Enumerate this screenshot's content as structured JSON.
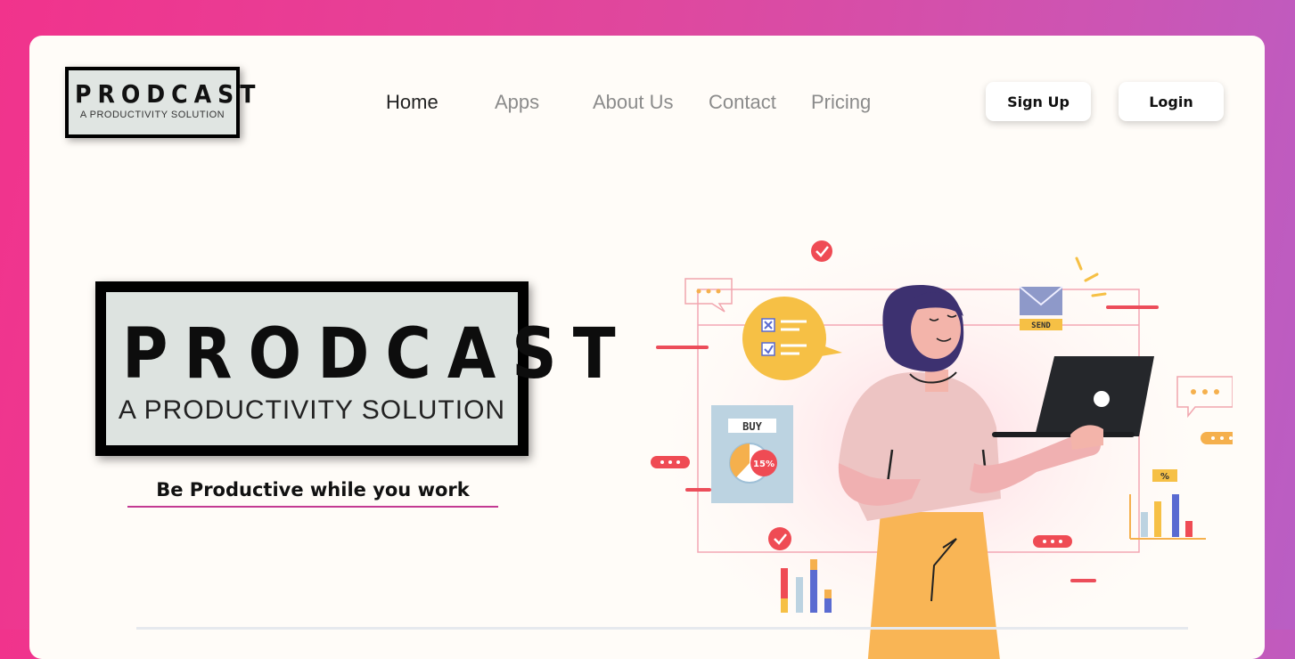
{
  "brand": {
    "name": "PRODCAST",
    "subtitle": "A PRODUCTIVITY SOLUTION"
  },
  "nav": {
    "items": [
      {
        "label": "Home",
        "active": true
      },
      {
        "label": "Apps",
        "active": false
      },
      {
        "label": "About Us",
        "active": false
      },
      {
        "label": "Contact",
        "active": false
      },
      {
        "label": "Pricing",
        "active": false
      }
    ]
  },
  "auth": {
    "signup_label": "Sign Up",
    "login_label": "Login"
  },
  "hero": {
    "title": "PRODCAST",
    "subtitle": "A PRODUCTIVITY SOLUTION",
    "tagline": "Be Productive while you work"
  },
  "illustration": {
    "buy_label": "BUY",
    "discount_label": "15%",
    "send_label": "SEND",
    "percent_label": "%"
  },
  "colors": {
    "accent": "#c33a93",
    "background_gradient_start": "#f1338c",
    "background_gradient_end": "#b95ec4"
  }
}
